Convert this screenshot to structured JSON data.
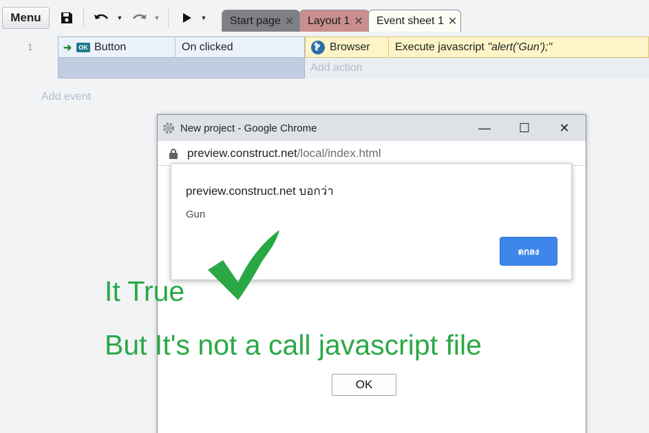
{
  "toolbar": {
    "menu_label": "Menu",
    "icons": [
      "save-icon",
      "undo-icon",
      "redo-icon",
      "play-icon"
    ]
  },
  "tabs": [
    {
      "label": "Start page"
    },
    {
      "label": "Layout 1"
    },
    {
      "label": "Event sheet 1"
    }
  ],
  "event_sheet": {
    "row_number": "1",
    "condition": {
      "badge": "OK",
      "object": "Button",
      "text": "On clicked"
    },
    "action": {
      "object": "Browser",
      "text_prefix": "Execute javascript ",
      "text_value": "\"alert('Gun');\""
    },
    "add_action": "Add action",
    "add_event": "Add event"
  },
  "browser_window": {
    "title": "New project - Google Chrome",
    "controls": {
      "minimize": "—",
      "maximize": "☐",
      "close": "✕"
    },
    "url_host": "preview.construct.net",
    "url_path": "/local/index.html"
  },
  "alert": {
    "title": "preview.construct.net บอกว่า",
    "message": "Gun",
    "ok_label": "ตกลง"
  },
  "annotation": {
    "line1": "It True",
    "line2": "But It's not a call javascript file",
    "color": "#2aa845"
  },
  "page_button": {
    "label": "OK"
  }
}
